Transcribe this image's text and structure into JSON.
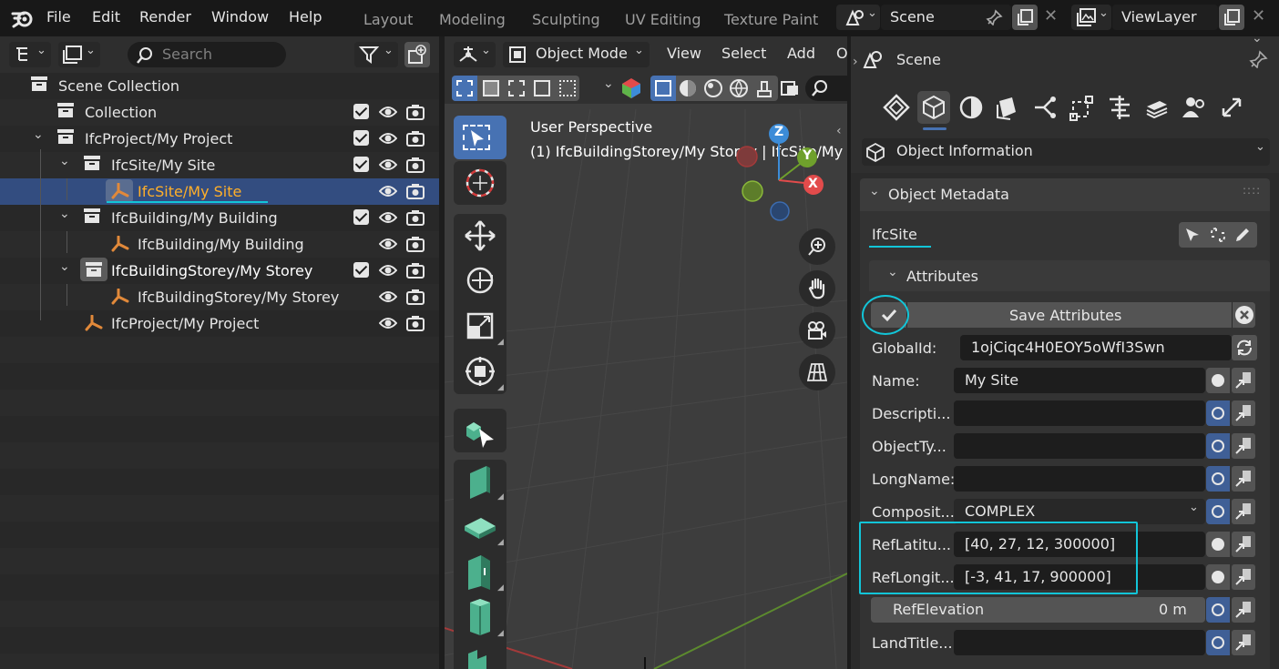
{
  "menubar": {
    "items": [
      "File",
      "Edit",
      "Render",
      "Window",
      "Help"
    ]
  },
  "workspaces": [
    "Layout",
    "Modeling",
    "Sculpting",
    "UV Editing",
    "Texture Paint"
  ],
  "scene_selector": {
    "value": "Scene"
  },
  "viewlayer_selector": {
    "value": "ViewLayer"
  },
  "outliner": {
    "search_placeholder": "Search",
    "rows": [
      {
        "label": "Scene Collection"
      },
      {
        "label": "Collection"
      },
      {
        "label": "IfcProject/My Project"
      },
      {
        "label": "IfcSite/My Site"
      },
      {
        "label": "IfcSite/My Site"
      },
      {
        "label": "IfcBuilding/My Building"
      },
      {
        "label": "IfcBuilding/My Building"
      },
      {
        "label": "IfcBuildingStorey/My Storey"
      },
      {
        "label": "IfcBuildingStorey/My Storey"
      },
      {
        "label": "IfcProject/My Project"
      }
    ]
  },
  "viewport": {
    "mode": "Object Mode",
    "menus": [
      "View",
      "Select",
      "Add",
      "O"
    ],
    "overlay_line1": "User Perspective",
    "overlay_line2": "(1) IfcBuildingStorey/My Storey | IfcSite/My",
    "gizmo": {
      "z": "Z",
      "y": "Y",
      "x": "X"
    }
  },
  "properties": {
    "header": "Scene",
    "panel_selector": "Object Information",
    "section": "Object Metadata",
    "entity_tab": "IfcSite",
    "subsection": "Attributes",
    "save_button": "Save Attributes",
    "attributes": [
      {
        "label": "GlobalId:",
        "value": "1ojCiqc4H0EOY5oWfI3Swn"
      },
      {
        "label": "Name:",
        "value": "My Site"
      },
      {
        "label": "Descripti...",
        "value": ""
      },
      {
        "label": "ObjectTy...",
        "value": ""
      },
      {
        "label": "LongName:",
        "value": ""
      },
      {
        "label": "Composit...",
        "value": "COMPLEX"
      },
      {
        "label": "RefLatitu...",
        "value": "[40, 27, 12, 300000]"
      },
      {
        "label": "RefLongit...",
        "value": "[-3, 41, 17, 900000]"
      },
      {
        "label": "RefElevation",
        "value": "0 m"
      },
      {
        "label": "LandTitle...",
        "value": ""
      }
    ]
  },
  "colors": {
    "accent": "#4772b3",
    "highlight": "#12c5d8",
    "selected_text": "#ffaf29",
    "object_icon": "#e1893a"
  }
}
